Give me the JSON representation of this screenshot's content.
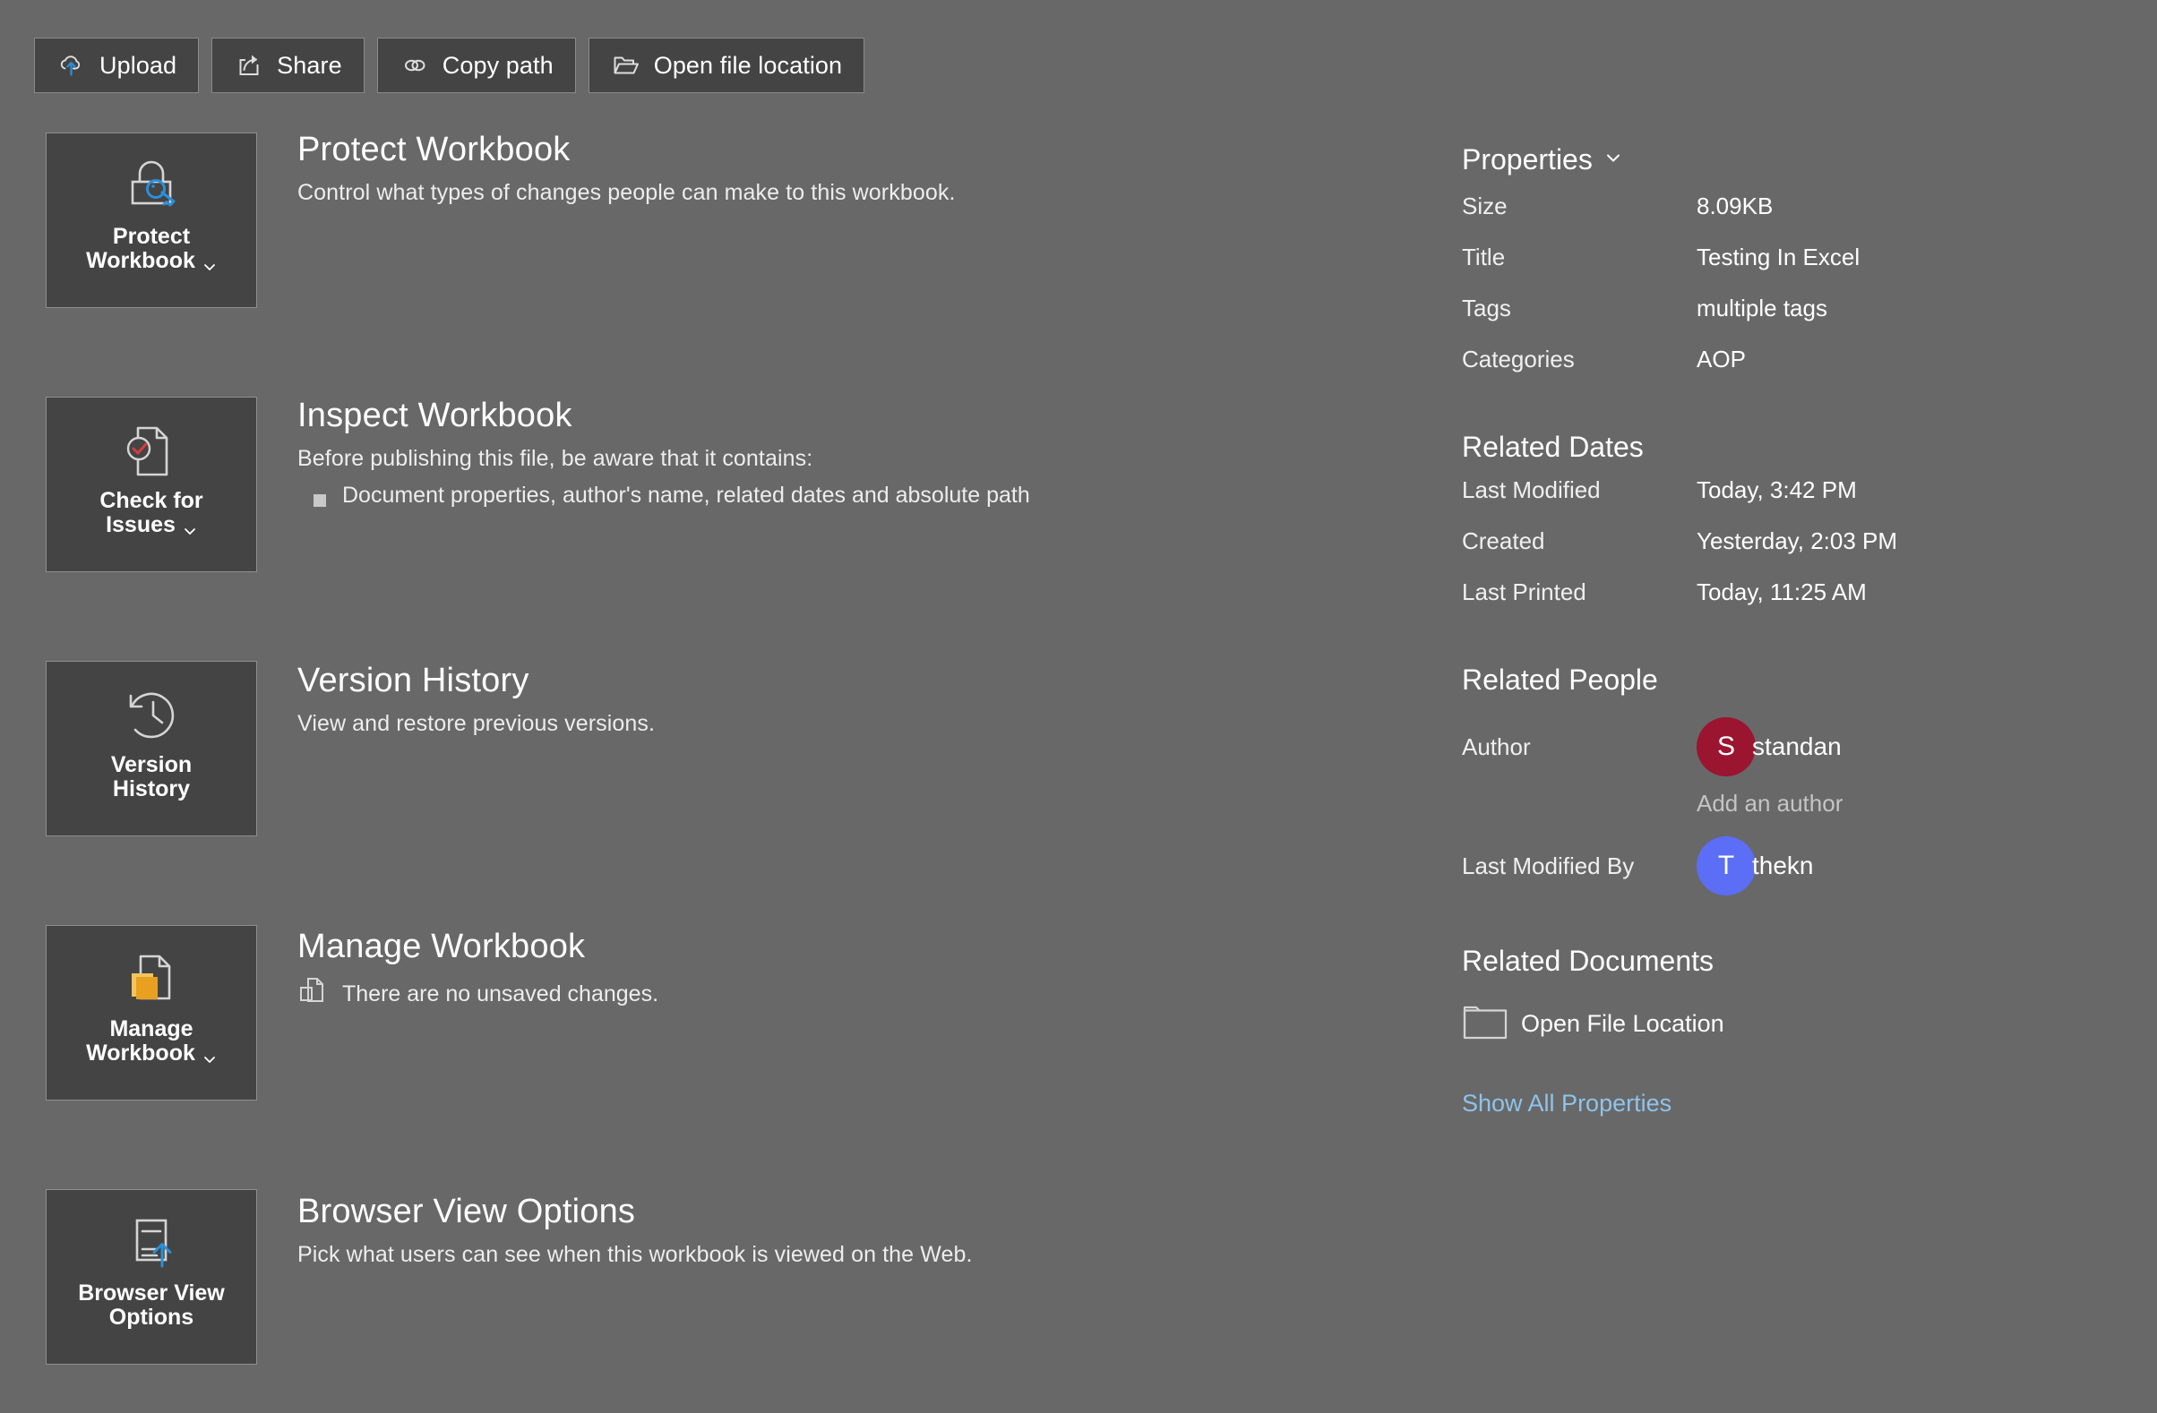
{
  "colors": {
    "page_bg": "#686868",
    "tile_bg": "#444444",
    "tile_border": "#8f8f8f",
    "accent_blue": "#2b8fd8",
    "accent_orange": "#e8a020",
    "accent_red": "#d83c3c",
    "link_blue": "#8fc3ea",
    "avatar_author_bg": "#9b1430",
    "avatar_modified_bg": "#5b6ef5"
  },
  "toolbar": {
    "buttons": [
      {
        "label": "Upload",
        "icon": "cloud-upload-icon"
      },
      {
        "label": "Share",
        "icon": "share-icon"
      },
      {
        "label": "Copy path",
        "icon": "link-icon"
      },
      {
        "label": "Open file location",
        "icon": "folder-open-icon"
      }
    ]
  },
  "tiles": [
    {
      "icon": "lock-key-icon",
      "line1": "Protect",
      "line2": "Workbook",
      "has_chevron": true
    },
    {
      "icon": "document-check-icon",
      "line1": "Check for",
      "line2": "Issues",
      "has_chevron": true
    },
    {
      "icon": "clock-history-icon",
      "line1": "Version",
      "line2": "History",
      "has_chevron": false
    },
    {
      "icon": "document-stack-icon",
      "line1": "Manage",
      "line2": "Workbook",
      "has_chevron": true
    },
    {
      "icon": "document-upload-icon",
      "line1": "Browser View",
      "line2": "Options",
      "has_chevron": false
    }
  ],
  "sections": [
    {
      "title": "Protect Workbook",
      "desc": "Control what types of changes people can make to this workbook."
    },
    {
      "title": "Inspect Workbook",
      "desc": "Before publishing this file, be aware that it contains:",
      "bullet": "Document properties, author's name, related dates and absolute path"
    },
    {
      "title": "Version History",
      "desc": "View and restore previous versions."
    },
    {
      "title": "Manage Workbook",
      "status": "There are no unsaved changes.",
      "status_icon": "document-copy-icon"
    },
    {
      "title": "Browser View Options",
      "desc": "Pick what users can see when this workbook is viewed on the Web."
    }
  ],
  "properties": {
    "header": "Properties",
    "header_icon": "chevron-down-icon",
    "rows": [
      {
        "key": "Size",
        "value": "8.09KB"
      },
      {
        "key": "Title",
        "value": "Testing In Excel"
      },
      {
        "key": "Tags",
        "value": "multiple tags"
      },
      {
        "key": "Categories",
        "value": "AOP"
      }
    ]
  },
  "related_dates": {
    "title": "Related Dates",
    "rows": [
      {
        "key": "Last Modified",
        "value": "Today, 3:42 PM"
      },
      {
        "key": "Created",
        "value": "Yesterday, 2:03 PM"
      },
      {
        "key": "Last Printed",
        "value": "Today, 11:25 AM"
      }
    ]
  },
  "related_people": {
    "title": "Related People",
    "author_key": "Author",
    "author_initial": "S",
    "author_name": "standan",
    "add_author": "Add an author",
    "modified_key": "Last Modified By",
    "modified_initial": "T",
    "modified_name": "thekn"
  },
  "related_documents": {
    "title": "Related Documents",
    "link_label": "Open File Location",
    "link_icon": "folder-icon"
  },
  "show_all_properties": "Show All Properties"
}
